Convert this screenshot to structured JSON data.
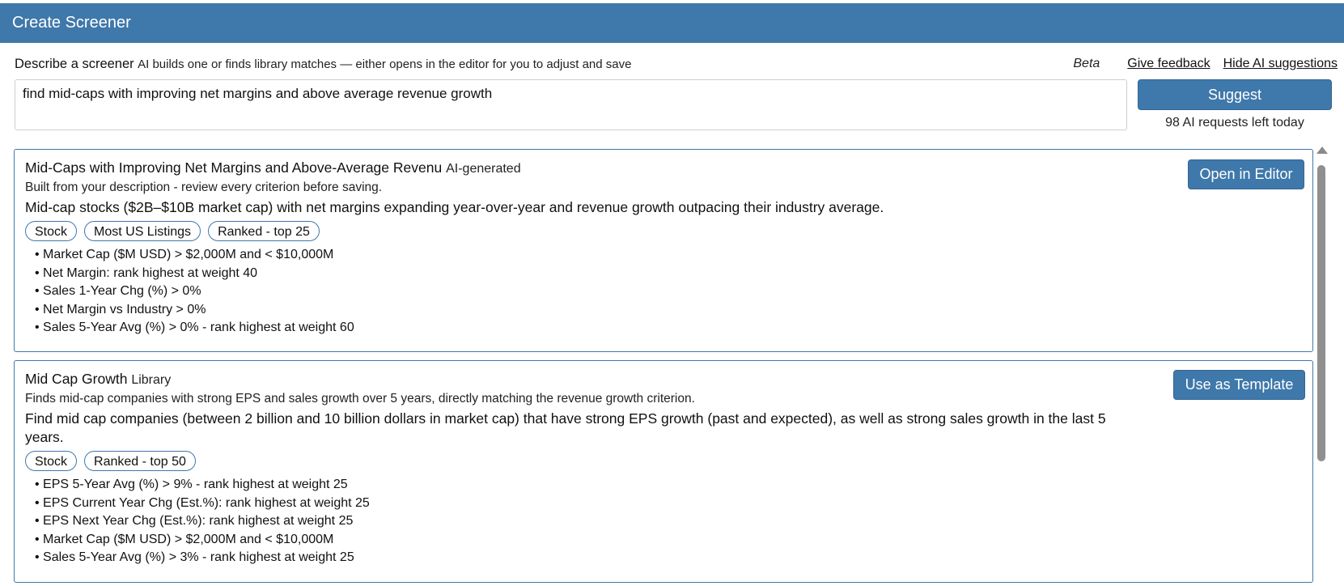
{
  "header": {
    "title": "Create Screener"
  },
  "prompt": {
    "lead": "Describe a screener",
    "sub": "AI builds one or finds library matches — either opens in the editor for you to adjust and save",
    "beta": "Beta",
    "feedback_link": "Give feedback",
    "hide_link": "Hide AI suggestions",
    "query_value": "find mid-caps with improving net margins and above average revenue growth",
    "suggest_label": "Suggest",
    "requests_left": "98 AI requests left today"
  },
  "results": [
    {
      "title": "Mid-Caps with Improving Net Margins and Above-Average Revenu",
      "tag": "AI-generated",
      "note": "Built from your description - review every criterion before saving.",
      "description": "Mid-cap stocks ($2B–$10B market cap) with net margins expanding year-over-year and revenue growth outpacing their industry average.",
      "chips": [
        "Stock",
        "Most US Listings",
        "Ranked - top 25"
      ],
      "criteria": [
        "Market Cap ($M USD) > $2,000M and < $10,000M",
        "Net Margin: rank highest at weight 40",
        "Sales 1-Year Chg (%) > 0%",
        "Net Margin vs Industry > 0%",
        "Sales 5-Year Avg (%) > 0% - rank highest at weight 60"
      ],
      "action_label": "Open in Editor"
    },
    {
      "title": "Mid Cap Growth",
      "tag": "Library",
      "note": "Finds mid-cap companies with strong EPS and sales growth over 5 years, directly matching the revenue growth criterion.",
      "description": "Find mid cap companies (between 2 billion and 10 billion dollars in market cap) that have strong EPS growth (past and expected), as well as strong sales growth in the last 5 years.",
      "chips": [
        "Stock",
        "Ranked - top 50"
      ],
      "criteria": [
        "EPS 5-Year Avg (%) > 9% - rank highest at weight 25",
        "EPS Current Year Chg (Est.%): rank highest at weight 25",
        "EPS Next Year Chg (Est.%): rank highest at weight 25",
        "Market Cap ($M USD) > $2,000M and < $10,000M",
        "Sales 5-Year Avg (%) > 3% - rank highest at weight 25"
      ],
      "action_label": "Use as Template"
    }
  ],
  "colors": {
    "accent": "#3f78aa",
    "border": "#3f78aa",
    "scrollbar": "#8f8f8f"
  }
}
